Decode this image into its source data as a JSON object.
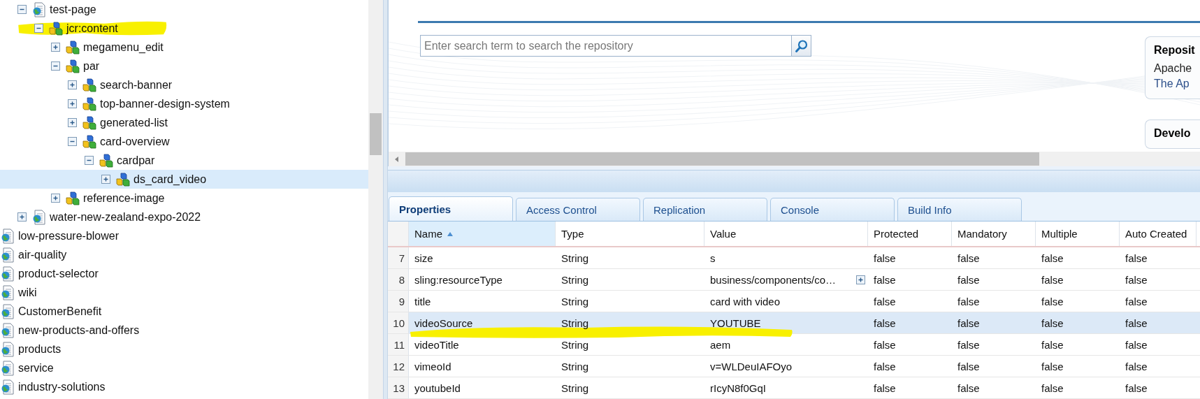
{
  "tree": {
    "items": [
      {
        "label": "test-page",
        "kind": "page",
        "expandable": true,
        "expanded": true,
        "selected": false,
        "marked": false,
        "children": [
          {
            "label": "jcr:content",
            "kind": "node",
            "expandable": true,
            "expanded": true,
            "selected": false,
            "marked": true,
            "children": [
              {
                "label": "megamenu_edit",
                "kind": "node",
                "expandable": true,
                "expanded": false,
                "selected": false,
                "marked": false
              },
              {
                "label": "par",
                "kind": "node",
                "expandable": true,
                "expanded": true,
                "selected": false,
                "marked": false,
                "children": [
                  {
                    "label": "search-banner",
                    "kind": "node",
                    "expandable": true,
                    "expanded": false,
                    "selected": false,
                    "marked": false
                  },
                  {
                    "label": "top-banner-design-system",
                    "kind": "node",
                    "expandable": true,
                    "expanded": false,
                    "selected": false,
                    "marked": false
                  },
                  {
                    "label": "generated-list",
                    "kind": "node",
                    "expandable": true,
                    "expanded": false,
                    "selected": false,
                    "marked": false
                  },
                  {
                    "label": "card-overview",
                    "kind": "node",
                    "expandable": true,
                    "expanded": true,
                    "selected": false,
                    "marked": false,
                    "children": [
                      {
                        "label": "cardpar",
                        "kind": "node",
                        "expandable": true,
                        "expanded": true,
                        "selected": false,
                        "marked": false,
                        "children": [
                          {
                            "label": "ds_card_video",
                            "kind": "node",
                            "expandable": true,
                            "expanded": false,
                            "selected": true,
                            "marked": false
                          }
                        ]
                      }
                    ]
                  }
                ]
              },
              {
                "label": "reference-image",
                "kind": "node",
                "expandable": true,
                "expanded": false,
                "selected": false,
                "marked": false
              }
            ]
          }
        ]
      },
      {
        "label": "water-new-zealand-expo-2022",
        "kind": "page",
        "expandable": true,
        "expanded": false,
        "selected": false,
        "marked": false
      },
      {
        "label": "low-pressure-blower",
        "kind": "page",
        "expandable": false,
        "selected": false,
        "marked": false
      },
      {
        "label": "air-quality",
        "kind": "page",
        "expandable": false,
        "selected": false,
        "marked": false
      },
      {
        "label": "product-selector",
        "kind": "page",
        "expandable": false,
        "selected": false,
        "marked": false
      },
      {
        "label": "wiki",
        "kind": "page",
        "expandable": false,
        "selected": false,
        "marked": false
      },
      {
        "label": "CustomerBenefit",
        "kind": "page",
        "expandable": false,
        "selected": false,
        "marked": false
      },
      {
        "label": "new-products-and-offers",
        "kind": "page",
        "expandable": false,
        "selected": false,
        "marked": false
      },
      {
        "label": "products",
        "kind": "page",
        "expandable": false,
        "selected": false,
        "marked": false
      },
      {
        "label": "service",
        "kind": "page",
        "expandable": false,
        "selected": false,
        "marked": false
      },
      {
        "label": "industry-solutions",
        "kind": "page",
        "expandable": false,
        "selected": false,
        "marked": false
      }
    ]
  },
  "top_view": {
    "search": {
      "placeholder": "Enter search term to search the repository"
    },
    "cards": [
      {
        "title": "Reposit",
        "lines": [
          {
            "text": "Apache",
            "kind": "text"
          },
          {
            "text": "The Ap",
            "kind": "link"
          }
        ]
      },
      {
        "title": "Develo"
      }
    ]
  },
  "tabs": [
    {
      "label": "Properties",
      "selected": true
    },
    {
      "label": "Access Control",
      "selected": false
    },
    {
      "label": "Replication",
      "selected": false
    },
    {
      "label": "Console",
      "selected": false
    },
    {
      "label": "Build Info",
      "selected": false
    }
  ],
  "table": {
    "columns": [
      {
        "label": "Name",
        "sorted": true
      },
      {
        "label": "Type",
        "sorted": false
      },
      {
        "label": "Value",
        "sorted": false
      },
      {
        "label": "Protected",
        "sorted": false
      },
      {
        "label": "Mandatory",
        "sorted": false
      },
      {
        "label": "Multiple",
        "sorted": false
      },
      {
        "label": "Auto Created",
        "sorted": false
      }
    ],
    "rows": [
      {
        "number": "7",
        "cells": [
          "size",
          "String",
          "s",
          "false",
          "false",
          "false",
          "false"
        ],
        "value_expandable": false,
        "selected": false,
        "marked": false
      },
      {
        "number": "8",
        "cells": [
          "sling:resourceType",
          "String",
          "business/components/co…",
          "false",
          "false",
          "false",
          "false"
        ],
        "value_expandable": true,
        "selected": false,
        "marked": false
      },
      {
        "number": "9",
        "cells": [
          "title",
          "String",
          "card with video",
          "false",
          "false",
          "false",
          "false"
        ],
        "value_expandable": false,
        "selected": false,
        "marked": false
      },
      {
        "number": "10",
        "cells": [
          "videoSource",
          "String",
          "YOUTUBE",
          "false",
          "false",
          "false",
          "false"
        ],
        "value_expandable": false,
        "selected": true,
        "marked": true
      },
      {
        "number": "11",
        "cells": [
          "videoTitle",
          "String",
          "aem",
          "false",
          "false",
          "false",
          "false"
        ],
        "value_expandable": false,
        "selected": false,
        "marked": false
      },
      {
        "number": "12",
        "cells": [
          "vimeoId",
          "String",
          "v=WLDeuIAFOyo",
          "false",
          "false",
          "false",
          "false"
        ],
        "value_expandable": false,
        "selected": false,
        "marked": false
      },
      {
        "number": "13",
        "cells": [
          "youtubeId",
          "String",
          "rIcyN8f0GqI",
          "false",
          "false",
          "false",
          "false"
        ],
        "value_expandable": false,
        "selected": false,
        "marked": false
      }
    ]
  }
}
